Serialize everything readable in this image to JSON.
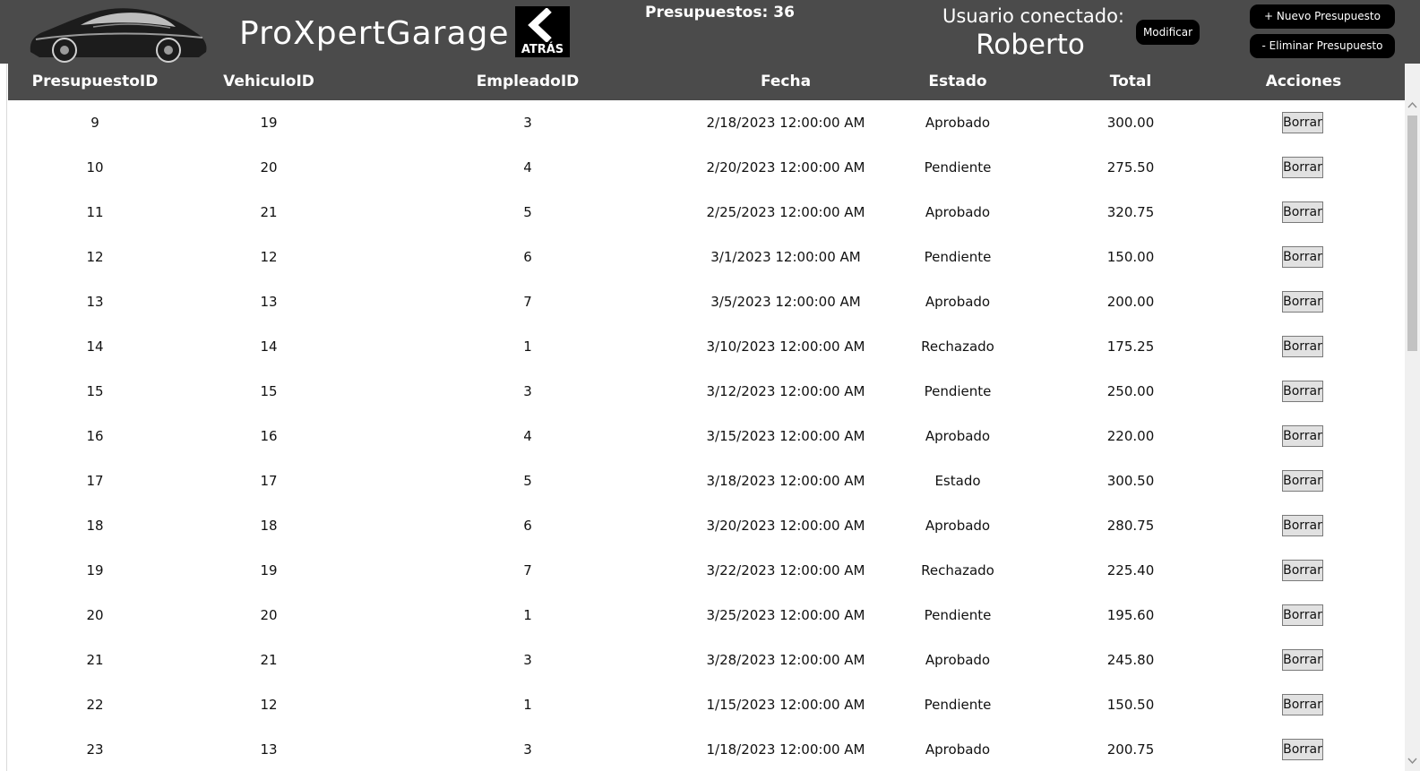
{
  "header": {
    "app_title": "ProXpertGarage",
    "back_label": "ATRÁS",
    "count_label": "Presupuestos:",
    "count_value": "36",
    "user_label": "Usuario conectado:",
    "user_name": "Roberto",
    "modify_label": "Modificar",
    "new_label": "+ Nuevo Presupuesto",
    "delete_label": "- Eliminar Presupuesto"
  },
  "table": {
    "columns": [
      "PresupuestoID",
      "VehiculoID",
      "EmpleadoID",
      "Fecha",
      "Estado",
      "Total",
      "Acciones"
    ],
    "action_label": "Borrar",
    "rows": [
      [
        "9",
        "19",
        "3",
        "2/18/2023 12:00:00 AM",
        "Aprobado",
        "300.00"
      ],
      [
        "10",
        "20",
        "4",
        "2/20/2023 12:00:00 AM",
        "Pendiente",
        "275.50"
      ],
      [
        "11",
        "21",
        "5",
        "2/25/2023 12:00:00 AM",
        "Aprobado",
        "320.75"
      ],
      [
        "12",
        "12",
        "6",
        "3/1/2023 12:00:00 AM",
        "Pendiente",
        "150.00"
      ],
      [
        "13",
        "13",
        "7",
        "3/5/2023 12:00:00 AM",
        "Aprobado",
        "200.00"
      ],
      [
        "14",
        "14",
        "1",
        "3/10/2023 12:00:00 AM",
        "Rechazado",
        "175.25"
      ],
      [
        "15",
        "15",
        "3",
        "3/12/2023 12:00:00 AM",
        "Pendiente",
        "250.00"
      ],
      [
        "16",
        "16",
        "4",
        "3/15/2023 12:00:00 AM",
        "Aprobado",
        "220.00"
      ],
      [
        "17",
        "17",
        "5",
        "3/18/2023 12:00:00 AM",
        "Estado",
        "300.50"
      ],
      [
        "18",
        "18",
        "6",
        "3/20/2023 12:00:00 AM",
        "Aprobado",
        "280.75"
      ],
      [
        "19",
        "19",
        "7",
        "3/22/2023 12:00:00 AM",
        "Rechazado",
        "225.40"
      ],
      [
        "20",
        "20",
        "1",
        "3/25/2023 12:00:00 AM",
        "Pendiente",
        "195.60"
      ],
      [
        "21",
        "21",
        "3",
        "3/28/2023 12:00:00 AM",
        "Aprobado",
        "245.80"
      ],
      [
        "22",
        "12",
        "1",
        "1/15/2023 12:00:00 AM",
        "Pendiente",
        "150.50"
      ],
      [
        "23",
        "13",
        "3",
        "1/18/2023 12:00:00 AM",
        "Aprobado",
        "200.75"
      ]
    ]
  },
  "icons": {
    "logo": "car-logo-icon",
    "back": "chevron-left-icon",
    "scroll_up": "scroll-up-arrow-icon",
    "scroll_down": "scroll-down-arrow-icon"
  },
  "colors": {
    "header_bg": "#4b4b4b",
    "button_bg": "#000000",
    "row_action_bg": "#e1e1e1"
  }
}
